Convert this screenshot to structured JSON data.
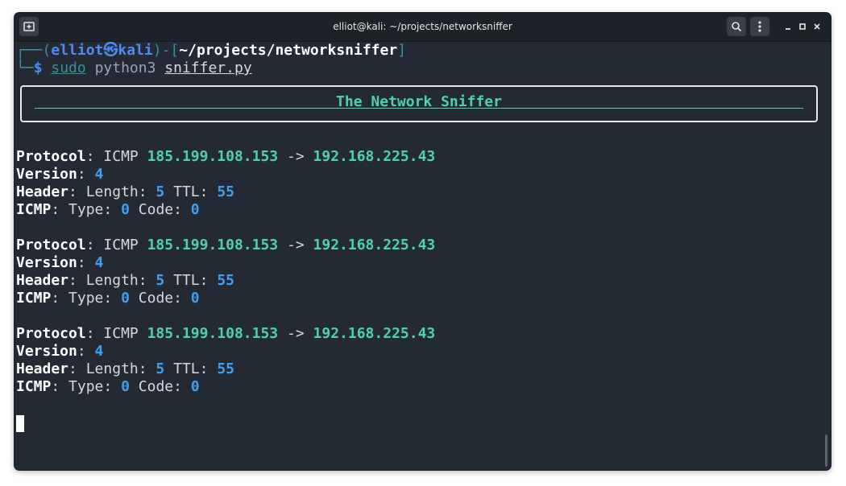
{
  "window": {
    "title": "elliot@kali: ~/projects/networksniffer"
  },
  "titlebar": {
    "new_tab_icon": "new-tab-icon",
    "search_icon": "search-icon",
    "menu_icon": "kebab-menu-icon",
    "minimize_glyph": "⌄",
    "maximize_glyph": "□",
    "close_glyph": "✕"
  },
  "prompt": {
    "corner_top": "┌──(",
    "user": "elliot",
    "skull": "㉿",
    "host": "kali",
    "bracket_mid": ")-[",
    "path": "~/projects/networksniffer",
    "bracket_end": "]",
    "corner_bottom": "└─",
    "dollar": "$",
    "cmd_sudo": "sudo",
    "cmd_python": "python3",
    "cmd_script": "sniffer.py"
  },
  "banner": {
    "title": "The Network Sniffer"
  },
  "labels": {
    "protocol": "Protocol",
    "version": "Version",
    "header": "Header",
    "icmp": "ICMP",
    "length": "Length:",
    "ttl": "TTL:",
    "type": "Type:",
    "code": "Code:",
    "arrow": "->",
    "colon": ":"
  },
  "packets": [
    {
      "proto": "ICMP",
      "src": "185.199.108.153",
      "dst": "192.168.225.43",
      "version": "4",
      "length": "5",
      "ttl": "55",
      "type": "0",
      "code": "0"
    },
    {
      "proto": "ICMP",
      "src": "185.199.108.153",
      "dst": "192.168.225.43",
      "version": "4",
      "length": "5",
      "ttl": "55",
      "type": "0",
      "code": "0"
    },
    {
      "proto": "ICMP",
      "src": "185.199.108.153",
      "dst": "192.168.225.43",
      "version": "4",
      "length": "5",
      "ttl": "55",
      "type": "0",
      "code": "0"
    }
  ],
  "colors": {
    "terminal_bg": "#232a33",
    "ip": "#4fd1b0",
    "number": "#3ea0f0",
    "prompt_blue": "#4d8cf4"
  }
}
